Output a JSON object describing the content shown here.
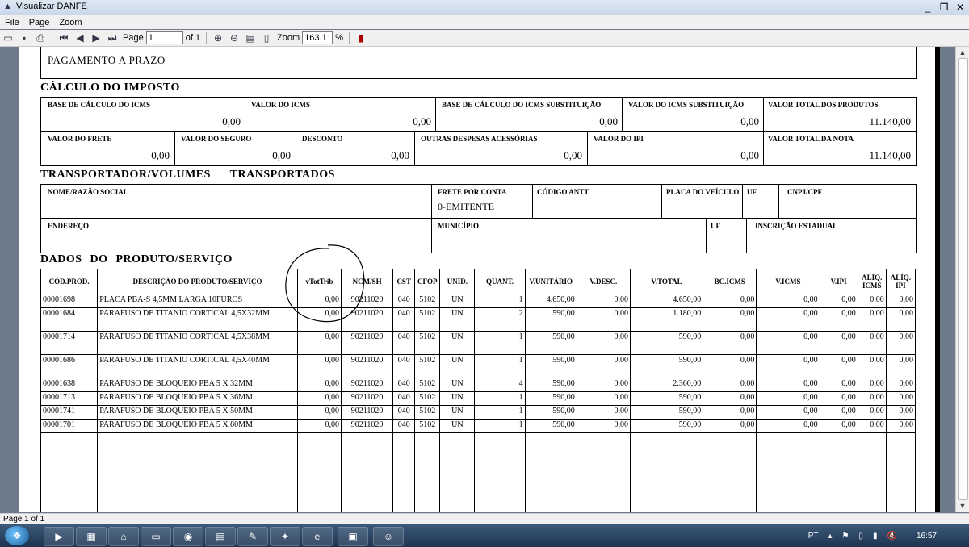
{
  "window": {
    "title": "Visualizar DANFE",
    "controls": [
      "_",
      "❐",
      "✕"
    ]
  },
  "menu": [
    "File",
    "Page",
    "Zoom"
  ],
  "toolbar": {
    "page_label": "Page",
    "page_value": "1",
    "of_label": "of 1",
    "zoom_label": "Zoom",
    "zoom_value": "163.1",
    "percent": "%"
  },
  "doc": {
    "pagamento": "PAGAMENTO A PRAZO",
    "calculo": {
      "title": "CÁLCULO DO IMPOSTO",
      "row1": [
        {
          "label": "BASE DE CÁLCULO DO ICMS",
          "value": "0,00"
        },
        {
          "label": "VALOR DO ICMS",
          "value": "0,00"
        },
        {
          "label": "BASE DE CÁLCULO DO ICMS SUBSTITUIÇÃO",
          "value": "0,00"
        },
        {
          "label": "VALOR DO ICMS SUBSTITUIÇÃO",
          "value": "0,00"
        },
        {
          "label": "VALOR TOTAL DOS PRODUTOS",
          "value": "11.140,00"
        }
      ],
      "row2": [
        {
          "label": "VALOR DO FRETE",
          "value": "0,00"
        },
        {
          "label": "VALOR DO SEGURO",
          "value": "0,00"
        },
        {
          "label": "DESCONTO",
          "value": "0,00"
        },
        {
          "label": "OUTRAS DESPESAS ACESSÓRIAS",
          "value": "0,00"
        },
        {
          "label": "VALOR DO IPI",
          "value": "0,00"
        },
        {
          "label": "VALOR TOTAL DA NOTA",
          "value": "11.140,00"
        }
      ]
    },
    "transportador": {
      "title": "TRANSPORTADOR/VOLUMES TRANSPORTADOS",
      "nome_label": "NOME/RAZÃO SOCIAL",
      "frete_label": "FRETE POR CONTA",
      "frete_value": "0-EMITENTE",
      "codigo_label": "CÓDIGO ANTT",
      "placa_label": "PLACA DO VEÍCULO",
      "uf_label": "UF",
      "cnpj_label": "CNPJ/CPF",
      "endereco_label": "ENDEREÇO",
      "municipio_label": "MUNICÍPIO",
      "uf2_label": "UF",
      "ie_label": "INSCRIÇÃO ESTADUAL"
    },
    "produtos": {
      "title": "DADOS DO PRODUTO/SERVIÇO",
      "headers": [
        "CÓD.PROD.",
        "DESCRIÇÃO DO PRODUTO/SERVIÇO",
        "vTotTrib",
        "NCM/SH",
        "CST",
        "CFOP",
        "UNID.",
        "QUANT.",
        "V.UNITÁRIO",
        "V.DESC.",
        "V.TOTAL",
        "BC.ICMS",
        "V.ICMS",
        "V.IPI",
        "ALÍQ. ICMS",
        "ALÍQ. IPI"
      ],
      "rows": [
        [
          "00001698",
          "PLACA PBA-S 4,5MM LARGA 10FUROS",
          "0,00",
          "90211020",
          "040",
          "5102",
          "UN",
          "1",
          "4.650,00",
          "0,00",
          "4.650,00",
          "0,00",
          "0,00",
          "0,00",
          "0,00",
          "0,00"
        ],
        [
          "00001684",
          "PARAFUSO DE TITANIO CORTICAL 4,5X32MM",
          "0,00",
          "90211020",
          "040",
          "5102",
          "UN",
          "2",
          "590,00",
          "0,00",
          "1.180,00",
          "0,00",
          "0,00",
          "0,00",
          "0,00",
          "0,00"
        ],
        [
          "00001714",
          "PARAFUSO DE TITANIO CORTICAL 4,5X38MM",
          "0,00",
          "90211020",
          "040",
          "5102",
          "UN",
          "1",
          "590,00",
          "0,00",
          "590,00",
          "0,00",
          "0,00",
          "0,00",
          "0,00",
          "0,00"
        ],
        [
          "00001686",
          "PARAFUSO DE TITANIO CORTICAL 4,5X40MM",
          "0,00",
          "90211020",
          "040",
          "5102",
          "UN",
          "1",
          "590,00",
          "0,00",
          "590,00",
          "0,00",
          "0,00",
          "0,00",
          "0,00",
          "0,00"
        ],
        [
          "00001638",
          "PARAFUSO DE BLOQUEIO PBA 5 X 32MM",
          "0,00",
          "90211020",
          "040",
          "5102",
          "UN",
          "4",
          "590,00",
          "0,00",
          "2.360,00",
          "0,00",
          "0,00",
          "0,00",
          "0,00",
          "0,00"
        ],
        [
          "00001713",
          "PARAFUSO DE BLOQUEIO PBA 5 X 36MM",
          "0,00",
          "90211020",
          "040",
          "5102",
          "UN",
          "1",
          "590,00",
          "0,00",
          "590,00",
          "0,00",
          "0,00",
          "0,00",
          "0,00",
          "0,00"
        ],
        [
          "00001741",
          "PARAFUSO DE BLOQUEIO PBA 5 X 50MM",
          "0,00",
          "90211020",
          "040",
          "5102",
          "UN",
          "1",
          "590,00",
          "0,00",
          "590,00",
          "0,00",
          "0,00",
          "0,00",
          "0,00",
          "0,00"
        ],
        [
          "00001701",
          "PARAFUSO DE BLOQUEIO PBA 5 X 80MM",
          "0,00",
          "90211020",
          "040",
          "5102",
          "UN",
          "1",
          "590,00",
          "0,00",
          "590,00",
          "0,00",
          "0,00",
          "0,00",
          "0,00",
          "0,00"
        ]
      ]
    }
  },
  "status": "Page 1 of 1",
  "taskbar": {
    "lang": "PT",
    "clock": "16:57"
  }
}
